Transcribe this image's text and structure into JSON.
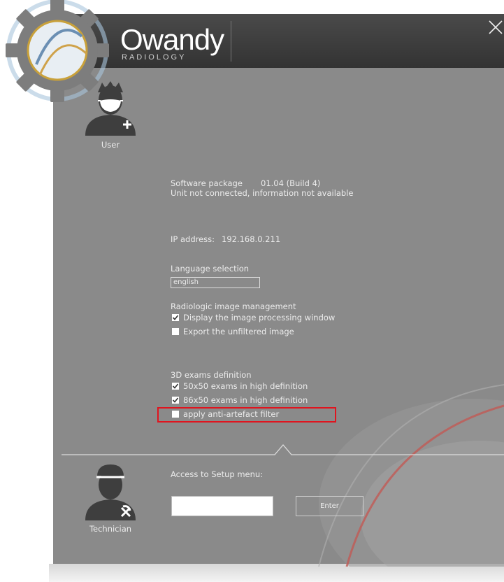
{
  "header": {
    "brand_name": "Owandy",
    "brand_sub": "RADIOLOGY"
  },
  "user": {
    "label": "User"
  },
  "info": {
    "software_label": "Software package",
    "software_version": "01.04 (Build 4)",
    "unit_status": "Unit not connected, information not available",
    "ip_label": "IP address:",
    "ip_value": "192.168.0.211"
  },
  "language": {
    "label": "Language selection",
    "value": "english"
  },
  "radiologic": {
    "title": "Radiologic image management",
    "options": [
      {
        "label": "Display the image processing window",
        "checked": true
      },
      {
        "label": "Export the unfiltered image",
        "checked": false
      }
    ]
  },
  "exams3d": {
    "title": "3D exams definition",
    "options": [
      {
        "label": "50x50 exams in high definition",
        "checked": true
      },
      {
        "label": "86x50 exams in high definition",
        "checked": true
      },
      {
        "label": "apply anti-artefact filter",
        "checked": false
      }
    ]
  },
  "technician": {
    "label": "Technician",
    "access_label": "Access to Setup menu:",
    "password_value": "",
    "enter_label": "Enter"
  },
  "colors": {
    "panel": "#8a8a8a",
    "header": "#3a3a3a",
    "highlight_box": "#e0141e",
    "text": "#ececec"
  }
}
